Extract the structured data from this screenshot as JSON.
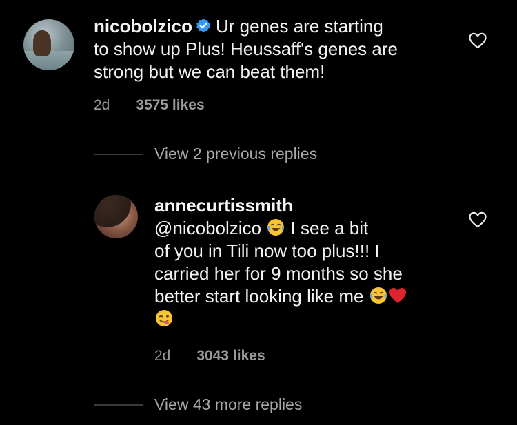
{
  "comments": [
    {
      "username": "nicobolzico",
      "text_line1": "Ur genes are starting",
      "text_line2": "to show up Plus! Heussaff's genes are",
      "text_line3": "strong but we can beat them!",
      "time": "2d",
      "likes": "3575 likes",
      "verified": true
    },
    {
      "username": "annecurtissmith",
      "mention": "@nicobolzico",
      "text_line1": "I see a bit",
      "text_line2": "of you in Tili now too plus!!! I",
      "text_line3": "carried her for 9 months so she",
      "text_line4": "better start looking like me",
      "time": "2d",
      "likes": "3043 likes"
    }
  ],
  "view_previous_replies": "View 2 previous replies",
  "view_more_replies": "View 43 more replies",
  "icons": {
    "verified": "verified-badge-icon",
    "like": "heart-outline-icon",
    "emoji_laugh": "face-with-tears-of-joy-icon",
    "emoji_heart": "red-heart-icon",
    "emoji_yum": "face-savoring-food-icon"
  },
  "colors": {
    "background": "#000000",
    "verified": "#3897f0",
    "heart": "#e0242e"
  }
}
